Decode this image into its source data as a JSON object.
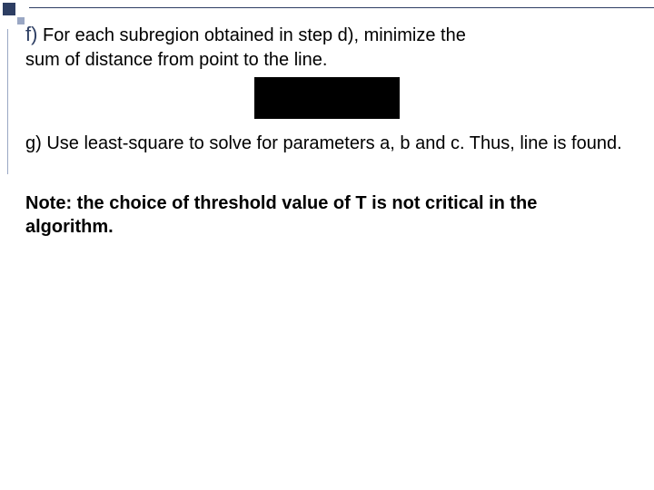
{
  "item_f": {
    "label": "f)",
    "text_part1": "For each subregion obtained in step d),   minimize the",
    "text_part2": "sum of distance from point to the line."
  },
  "item_g": {
    "text": "g)  Use least-square to solve for parameters a, b and c. Thus, line is found."
  },
  "note": {
    "text": "Note: the choice of threshold value of T is not critical in the algorithm."
  }
}
